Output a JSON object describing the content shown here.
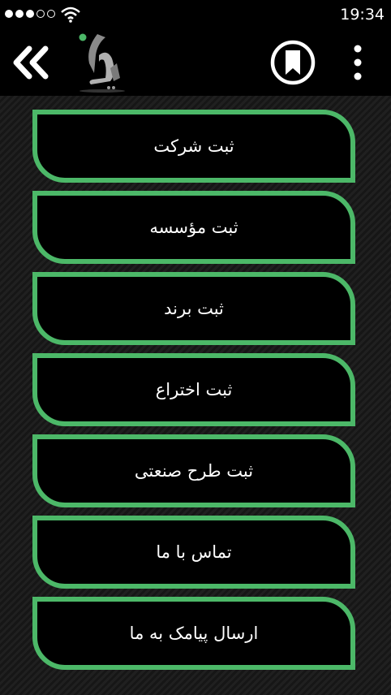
{
  "status": {
    "time": "19:34",
    "signal_icon": "signal-dots-icon",
    "wifi_icon": "wifi-icon"
  },
  "appbar": {
    "back_icon": "double-chevron-left-icon",
    "logo_icon": "app-logo",
    "bookmark_icon": "bookmark-icon",
    "more_icon": "more-vertical-icon"
  },
  "menu": [
    {
      "label": "ثبت شرکت"
    },
    {
      "label": "ثبت مؤسسه"
    },
    {
      "label": "ثبت برند"
    },
    {
      "label": "ثبت اختراع"
    },
    {
      "label": "ثبت طرح صنعتی"
    },
    {
      "label": "تماس با ما"
    },
    {
      "label": "ارسال پیامک به ما"
    }
  ],
  "colors": {
    "accent": "#4cb868",
    "background": "#000000",
    "text": "#ffffff"
  }
}
